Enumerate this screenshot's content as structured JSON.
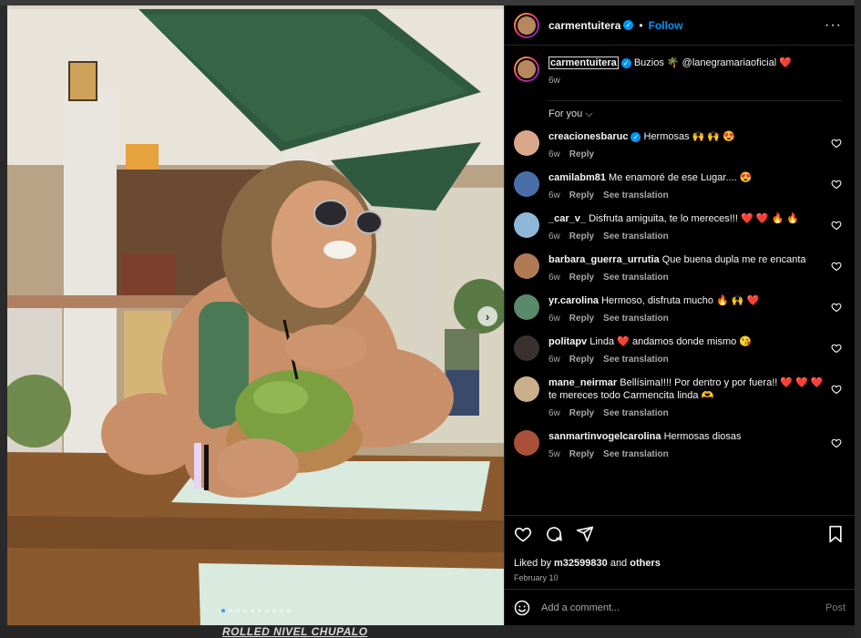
{
  "backdrop": {
    "bottom_text": "ROLLED NIVEL CHUPALO"
  },
  "post": {
    "author": "carmentuitera",
    "verified_badge": "✓",
    "separator": "•",
    "follow_label": "Follow",
    "more_label": "···",
    "caption_author": "carmentuitera",
    "caption_text": " Buzios 🌴 @lanegramariaoficial ❤️",
    "caption_time": "6w",
    "for_you": "For you ⌵",
    "next_arrow": "›",
    "carousel_dots": 10,
    "carousel_active": 0
  },
  "comments": [
    {
      "user": "creacionesbaruc",
      "verified": true,
      "text": "Hermosas 🙌 🙌 😍",
      "time": "6w",
      "reply": "Reply",
      "translate": "",
      "avatar_color": "#d9a88a"
    },
    {
      "user": "camilabm81",
      "verified": false,
      "text": "Me enamoré de ese Lugar.... 😍",
      "time": "6w",
      "reply": "Reply",
      "translate": "See translation",
      "avatar_color": "#4a6fa8"
    },
    {
      "user": "_car_v_",
      "verified": false,
      "text": "Disfruta amiguita, te lo mereces!!! ❤️ ❤️ 🔥 🔥",
      "time": "6w",
      "reply": "Reply",
      "translate": "See translation",
      "avatar_color": "#8fb8d8"
    },
    {
      "user": "barbara_guerra_urrutia",
      "verified": false,
      "text": "Que buena dupla me re encanta",
      "time": "6w",
      "reply": "Reply",
      "translate": "See translation",
      "avatar_color": "#b07a55"
    },
    {
      "user": "yr.carolina",
      "verified": false,
      "text": "Hermoso, disfruta mucho 🔥 🙌 ❤️",
      "time": "6w",
      "reply": "Reply",
      "translate": "See translation",
      "avatar_color": "#5a8a6a"
    },
    {
      "user": "politapv",
      "verified": false,
      "text": "Linda ❤️ andamos donde mismo 😘",
      "time": "6w",
      "reply": "Reply",
      "translate": "See translation",
      "avatar_color": "#3b3030"
    },
    {
      "user": "mane_neirmar",
      "verified": false,
      "text": "Bellísima!!!! Por dentro y por fuera!! ❤️ ❤️ ❤️ te mereces todo Carmencita linda 🫶",
      "time": "6w",
      "reply": "Reply",
      "translate": "See translation",
      "avatar_color": "#c9b08a"
    },
    {
      "user": "sanmartinvogelcarolina",
      "verified": false,
      "text": "Hermosas diosas",
      "time": "5w",
      "reply": "Reply",
      "translate": "See translation",
      "avatar_color": "#a8503a"
    }
  ],
  "actions": {
    "liked_prefix": "Liked by ",
    "liked_user": "m32599830",
    "liked_and": " and ",
    "liked_others": "others",
    "date": "February 10"
  },
  "add_comment": {
    "placeholder": "Add a comment...",
    "post_label": "Post"
  },
  "colors": {
    "accent": "#0095f6",
    "background": "#000000",
    "muted": "#a8a8a8"
  }
}
